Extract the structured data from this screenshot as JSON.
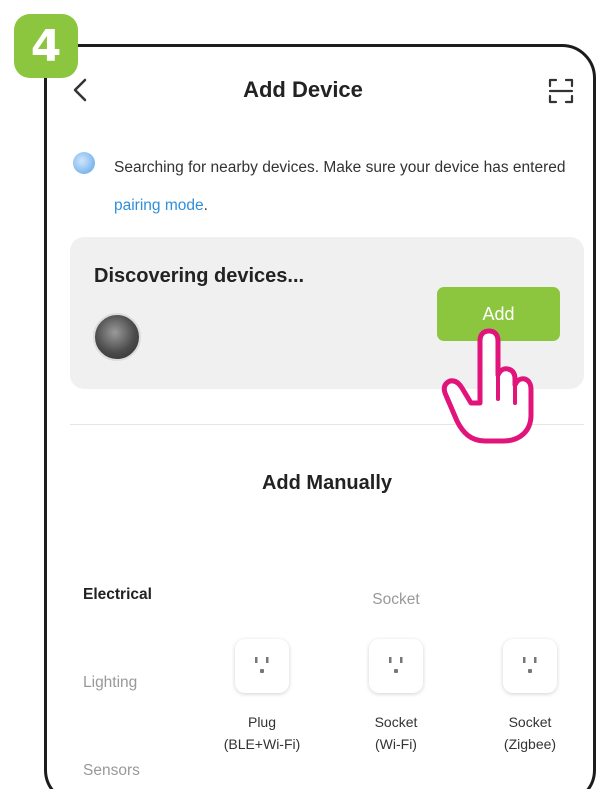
{
  "step": {
    "number": "4"
  },
  "header": {
    "title": "Add Device"
  },
  "notice": {
    "text_before": "Searching for nearby devices. Make sure your device has entered ",
    "link": "pairing mode",
    "text_after": "."
  },
  "discover": {
    "title": "Discovering devices...",
    "add_label": "Add"
  },
  "manual": {
    "title": "Add Manually",
    "categories": [
      {
        "label": "Electrical",
        "active": true
      },
      {
        "label": "Lighting",
        "active": false
      },
      {
        "label": "Sensors",
        "active": false
      }
    ],
    "group_title": "Socket",
    "devices": [
      {
        "line1": "Plug",
        "line2": "(BLE+Wi-Fi)"
      },
      {
        "line1": "Socket",
        "line2": "(Wi-Fi)"
      },
      {
        "line1": "Socket",
        "line2": "(Zigbee)"
      }
    ]
  },
  "colors": {
    "accent": "#8cc63f",
    "link": "#2f8fdc",
    "hand": "#e0147a"
  },
  "icons": [
    "back-arrow-icon",
    "scan-icon",
    "search-indicator-icon",
    "device-thumbnail",
    "pointing-hand-icon",
    "socket-icon"
  ]
}
